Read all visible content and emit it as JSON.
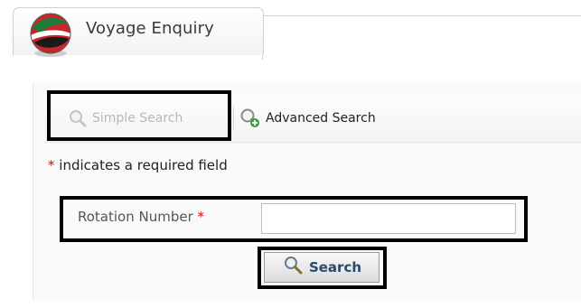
{
  "header": {
    "title": "Voyage Enquiry",
    "logo_icon": "globe-logo-icon"
  },
  "search_tabs": {
    "simple_label": "Simple Search",
    "advanced_label": "Advanced Search",
    "active": "simple"
  },
  "form": {
    "required_star": "*",
    "required_note": "indicates a required field",
    "rotation_label": "Rotation Number",
    "rotation_value": "",
    "search_button_label": "Search"
  },
  "colors": {
    "required_star": "#d01010",
    "disabled_text": "#b8b8b8",
    "button_text": "#2a4a6a"
  }
}
